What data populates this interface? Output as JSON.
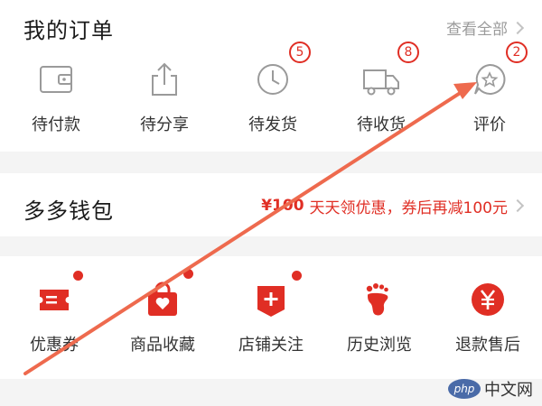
{
  "orders": {
    "title": "我的订单",
    "view_all": "查看全部",
    "items": [
      {
        "label": "待付款",
        "icon": "wallet-icon",
        "badge": null
      },
      {
        "label": "待分享",
        "icon": "share-icon",
        "badge": null
      },
      {
        "label": "待发货",
        "icon": "clock-icon",
        "badge": "5"
      },
      {
        "label": "待收货",
        "icon": "truck-icon",
        "badge": "8"
      },
      {
        "label": "评价",
        "icon": "review-star-icon",
        "badge": "2"
      }
    ]
  },
  "wallet": {
    "title": "多多钱包",
    "promo_amount": "¥100",
    "promo_text": "天天领优惠，券后再减100元"
  },
  "tools": [
    {
      "label": "优惠券",
      "icon": "coupon-icon",
      "dot": true
    },
    {
      "label": "商品收藏",
      "icon": "favorite-bag-icon",
      "dot": true
    },
    {
      "label": "店铺关注",
      "icon": "shop-follow-icon",
      "dot": true
    },
    {
      "label": "历史浏览",
      "icon": "footprint-icon",
      "dot": false
    },
    {
      "label": "退款售后",
      "icon": "refund-yen-icon",
      "dot": false
    }
  ],
  "watermark": {
    "logo": "php",
    "text": "中文网"
  },
  "colors": {
    "accent": "#e02e24",
    "annotation_arrow": "#ee6a4e",
    "gray_icon": "#9a9a9a"
  }
}
